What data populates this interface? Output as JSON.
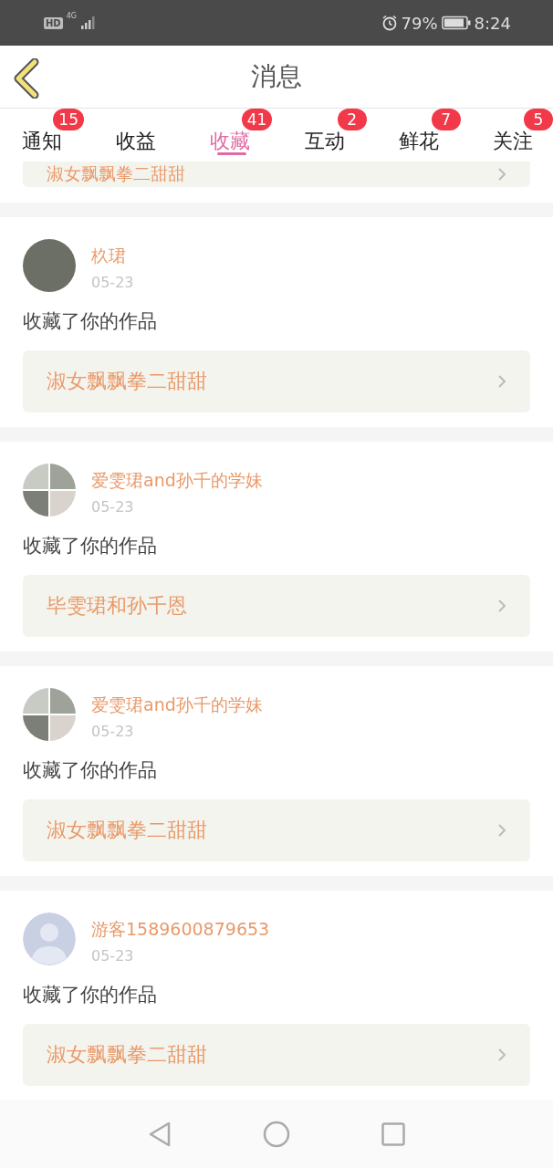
{
  "status_bar": {
    "hd": "HD",
    "network": "4G",
    "battery": "79%",
    "time": "8:24"
  },
  "header": {
    "title": "消息"
  },
  "tabs": [
    {
      "label": "通知",
      "badge": "15",
      "selected": false
    },
    {
      "label": "收益",
      "selected": false
    },
    {
      "label": "收藏",
      "badge": "41",
      "selected": true
    },
    {
      "label": "互动",
      "badge": "2",
      "selected": false
    },
    {
      "label": "鲜花",
      "badge": "7",
      "selected": false
    },
    {
      "label": "关注",
      "badge": "5",
      "selected": false
    }
  ],
  "partial_work": "淑女飘飘拳二甜甜",
  "messages": [
    {
      "name": "杦珺",
      "date": "05-23",
      "kind": "photo",
      "text": "收藏了你的作品",
      "work": "淑女飘飘拳二甜甜"
    },
    {
      "name": "爱雯珺and孙千的学妹",
      "date": "05-23",
      "kind": "collage",
      "text": "收藏了你的作品",
      "work": "毕雯珺和孙千恩"
    },
    {
      "name": "爱雯珺and孙千的学妹",
      "date": "05-23",
      "kind": "collage",
      "text": "收藏了你的作品",
      "work": "淑女飘飘拳二甜甜"
    },
    {
      "name": "游客1589600879653",
      "date": "05-23",
      "kind": "default",
      "text": "收藏了你的作品",
      "work": "淑女飘飘拳二甜甜"
    }
  ]
}
